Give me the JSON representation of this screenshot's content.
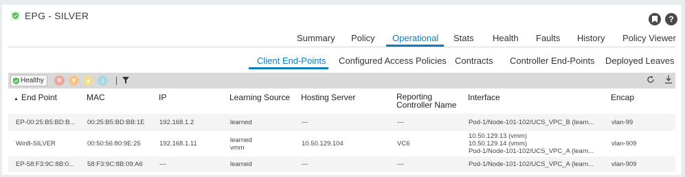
{
  "header": {
    "title": "EPG - SILVER"
  },
  "main_tabs": [
    "Summary",
    "Policy",
    "Operational",
    "Stats",
    "Health",
    "Faults",
    "History",
    "Policy Viewer"
  ],
  "sub_tabs": [
    "Client End-Points",
    "Configured Access Policies",
    "Contracts",
    "Controller End-Points",
    "Deployed Leaves"
  ],
  "toolbar": {
    "health_label": "Healthy"
  },
  "table": {
    "headers": [
      "End Point",
      "MAC",
      "IP",
      "Learning Source",
      "Hosting Server",
      "Reporting Controller Name",
      "Interface",
      "Encap"
    ],
    "rows": [
      {
        "end_point": "EP-00:25:B5:BD:B...",
        "mac": "00:25:B5:BD:BB:1E",
        "ip": "192.168.1.2",
        "learning_source": [
          "learned"
        ],
        "hosting_server": "---",
        "reporting_controller": "---",
        "interface": [
          "Pod-1/Node-101-102/UCS_VPC_B (learn..."
        ],
        "encap": "vlan-99"
      },
      {
        "end_point": "Win8-SILVER",
        "mac": "00:50:56:80:9E:25",
        "ip": "192.168.1.11",
        "learning_source": [
          "learned",
          "vmm"
        ],
        "hosting_server": "10.50.129.104",
        "reporting_controller": "VC6",
        "interface": [
          "10.50.129.13 (vmm)",
          "10.50.129.14 (vmm)",
          "Pod-1/Node-101-102/UCS_VPC_A (learn..."
        ],
        "encap": "vlan-909"
      },
      {
        "end_point": "EP-58:F3:9C:8B:0...",
        "mac": "58:F3:9C:8B:09:A6",
        "ip": "---",
        "learning_source": [
          "learned"
        ],
        "hosting_server": "---",
        "reporting_controller": "---",
        "interface": [
          "Pod-1/Node-101-102/UCS_VPC_A (learn..."
        ],
        "encap": "vlan-909"
      }
    ]
  },
  "colors": {
    "accent": "#0a7dc2",
    "critical": "#f0a59e",
    "major": "#f4c58a",
    "minor": "#f2dc8f",
    "warning": "#a9d7e3",
    "healthy": "#5cb85c"
  }
}
